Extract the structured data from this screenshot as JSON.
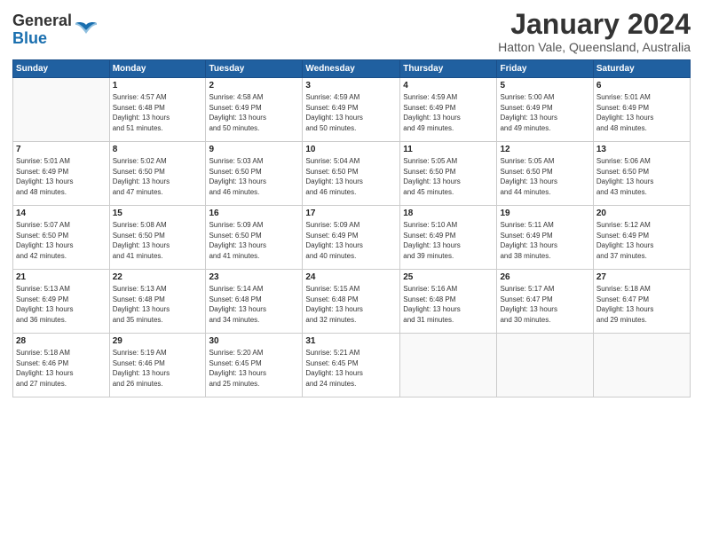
{
  "header": {
    "logo_general": "General",
    "logo_blue": "Blue",
    "title": "January 2024",
    "subtitle": "Hatton Vale, Queensland, Australia"
  },
  "days_of_week": [
    "Sunday",
    "Monday",
    "Tuesday",
    "Wednesday",
    "Thursday",
    "Friday",
    "Saturday"
  ],
  "weeks": [
    [
      {
        "day": "",
        "info": ""
      },
      {
        "day": "1",
        "info": "Sunrise: 4:57 AM\nSunset: 6:48 PM\nDaylight: 13 hours\nand 51 minutes."
      },
      {
        "day": "2",
        "info": "Sunrise: 4:58 AM\nSunset: 6:49 PM\nDaylight: 13 hours\nand 50 minutes."
      },
      {
        "day": "3",
        "info": "Sunrise: 4:59 AM\nSunset: 6:49 PM\nDaylight: 13 hours\nand 50 minutes."
      },
      {
        "day": "4",
        "info": "Sunrise: 4:59 AM\nSunset: 6:49 PM\nDaylight: 13 hours\nand 49 minutes."
      },
      {
        "day": "5",
        "info": "Sunrise: 5:00 AM\nSunset: 6:49 PM\nDaylight: 13 hours\nand 49 minutes."
      },
      {
        "day": "6",
        "info": "Sunrise: 5:01 AM\nSunset: 6:49 PM\nDaylight: 13 hours\nand 48 minutes."
      }
    ],
    [
      {
        "day": "7",
        "info": "Sunrise: 5:01 AM\nSunset: 6:49 PM\nDaylight: 13 hours\nand 48 minutes."
      },
      {
        "day": "8",
        "info": "Sunrise: 5:02 AM\nSunset: 6:50 PM\nDaylight: 13 hours\nand 47 minutes."
      },
      {
        "day": "9",
        "info": "Sunrise: 5:03 AM\nSunset: 6:50 PM\nDaylight: 13 hours\nand 46 minutes."
      },
      {
        "day": "10",
        "info": "Sunrise: 5:04 AM\nSunset: 6:50 PM\nDaylight: 13 hours\nand 46 minutes."
      },
      {
        "day": "11",
        "info": "Sunrise: 5:05 AM\nSunset: 6:50 PM\nDaylight: 13 hours\nand 45 minutes."
      },
      {
        "day": "12",
        "info": "Sunrise: 5:05 AM\nSunset: 6:50 PM\nDaylight: 13 hours\nand 44 minutes."
      },
      {
        "day": "13",
        "info": "Sunrise: 5:06 AM\nSunset: 6:50 PM\nDaylight: 13 hours\nand 43 minutes."
      }
    ],
    [
      {
        "day": "14",
        "info": "Sunrise: 5:07 AM\nSunset: 6:50 PM\nDaylight: 13 hours\nand 42 minutes."
      },
      {
        "day": "15",
        "info": "Sunrise: 5:08 AM\nSunset: 6:50 PM\nDaylight: 13 hours\nand 41 minutes."
      },
      {
        "day": "16",
        "info": "Sunrise: 5:09 AM\nSunset: 6:50 PM\nDaylight: 13 hours\nand 41 minutes."
      },
      {
        "day": "17",
        "info": "Sunrise: 5:09 AM\nSunset: 6:49 PM\nDaylight: 13 hours\nand 40 minutes."
      },
      {
        "day": "18",
        "info": "Sunrise: 5:10 AM\nSunset: 6:49 PM\nDaylight: 13 hours\nand 39 minutes."
      },
      {
        "day": "19",
        "info": "Sunrise: 5:11 AM\nSunset: 6:49 PM\nDaylight: 13 hours\nand 38 minutes."
      },
      {
        "day": "20",
        "info": "Sunrise: 5:12 AM\nSunset: 6:49 PM\nDaylight: 13 hours\nand 37 minutes."
      }
    ],
    [
      {
        "day": "21",
        "info": "Sunrise: 5:13 AM\nSunset: 6:49 PM\nDaylight: 13 hours\nand 36 minutes."
      },
      {
        "day": "22",
        "info": "Sunrise: 5:13 AM\nSunset: 6:48 PM\nDaylight: 13 hours\nand 35 minutes."
      },
      {
        "day": "23",
        "info": "Sunrise: 5:14 AM\nSunset: 6:48 PM\nDaylight: 13 hours\nand 34 minutes."
      },
      {
        "day": "24",
        "info": "Sunrise: 5:15 AM\nSunset: 6:48 PM\nDaylight: 13 hours\nand 32 minutes."
      },
      {
        "day": "25",
        "info": "Sunrise: 5:16 AM\nSunset: 6:48 PM\nDaylight: 13 hours\nand 31 minutes."
      },
      {
        "day": "26",
        "info": "Sunrise: 5:17 AM\nSunset: 6:47 PM\nDaylight: 13 hours\nand 30 minutes."
      },
      {
        "day": "27",
        "info": "Sunrise: 5:18 AM\nSunset: 6:47 PM\nDaylight: 13 hours\nand 29 minutes."
      }
    ],
    [
      {
        "day": "28",
        "info": "Sunrise: 5:18 AM\nSunset: 6:46 PM\nDaylight: 13 hours\nand 27 minutes."
      },
      {
        "day": "29",
        "info": "Sunrise: 5:19 AM\nSunset: 6:46 PM\nDaylight: 13 hours\nand 26 minutes."
      },
      {
        "day": "30",
        "info": "Sunrise: 5:20 AM\nSunset: 6:45 PM\nDaylight: 13 hours\nand 25 minutes."
      },
      {
        "day": "31",
        "info": "Sunrise: 5:21 AM\nSunset: 6:45 PM\nDaylight: 13 hours\nand 24 minutes."
      },
      {
        "day": "",
        "info": ""
      },
      {
        "day": "",
        "info": ""
      },
      {
        "day": "",
        "info": ""
      }
    ]
  ]
}
